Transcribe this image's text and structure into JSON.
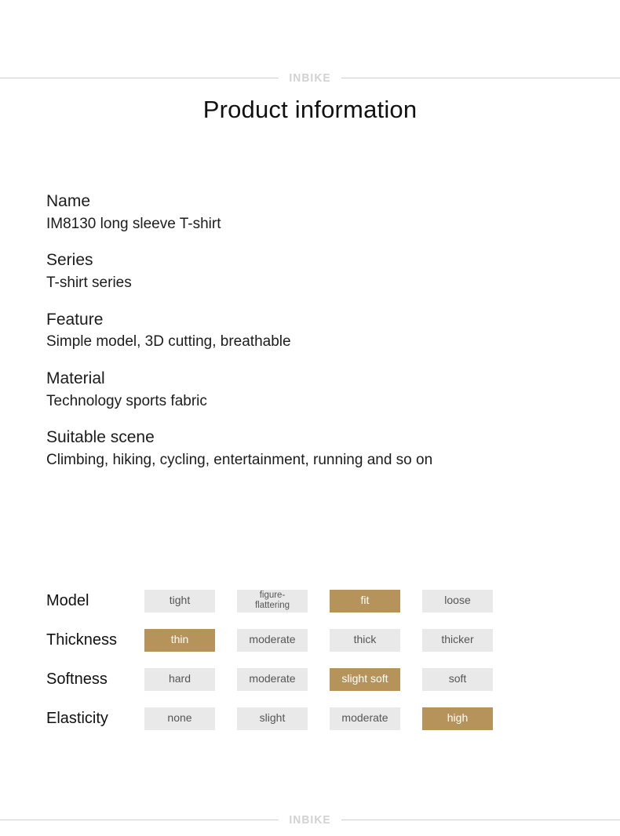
{
  "brand": {
    "header_text": "INBIKE",
    "footer_text": "INBIKE"
  },
  "title": "Product information",
  "specs": [
    {
      "label": "Name",
      "value": "IM8130 long sleeve T-shirt"
    },
    {
      "label": "Series",
      "value": "T-shirt series"
    },
    {
      "label": "Feature",
      "value": "Simple model, 3D cutting, breathable"
    },
    {
      "label": "Material",
      "value": "Technology sports fabric"
    },
    {
      "label": "Suitable scene",
      "value": "Climbing, hiking, cycling, entertainment, running and so on"
    }
  ],
  "attributes": [
    {
      "name": "Model",
      "options": [
        {
          "label": "tight",
          "selected": false
        },
        {
          "label": "figure-\nflattering",
          "selected": false
        },
        {
          "label": "fit",
          "selected": true
        },
        {
          "label": "loose",
          "selected": false
        }
      ]
    },
    {
      "name": "Thickness",
      "options": [
        {
          "label": "thin",
          "selected": true
        },
        {
          "label": "moderate",
          "selected": false
        },
        {
          "label": "thick",
          "selected": false
        },
        {
          "label": "thicker",
          "selected": false
        }
      ]
    },
    {
      "name": "Softness",
      "options": [
        {
          "label": "hard",
          "selected": false
        },
        {
          "label": "moderate",
          "selected": false
        },
        {
          "label": "slight soft",
          "selected": true
        },
        {
          "label": "soft",
          "selected": false
        }
      ]
    },
    {
      "name": "Elasticity",
      "options": [
        {
          "label": "none",
          "selected": false
        },
        {
          "label": "slight",
          "selected": false
        },
        {
          "label": "moderate",
          "selected": false
        },
        {
          "label": "high",
          "selected": true
        }
      ]
    }
  ],
  "colors": {
    "selected_chip": "#b5935a",
    "chip_background": "#e9e9e9",
    "chip_text": "#555555",
    "selected_chip_text": "#ffffff",
    "brand_text": "#d2d2d2",
    "rule_line": "#cfcfcf"
  }
}
